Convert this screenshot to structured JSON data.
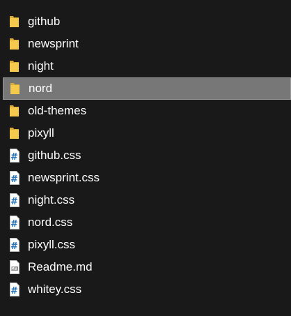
{
  "explorer": {
    "items": [
      {
        "label": "github",
        "type": "folder",
        "icon": "folder-icon"
      },
      {
        "label": "newsprint",
        "type": "folder",
        "icon": "folder-icon"
      },
      {
        "label": "night",
        "type": "folder",
        "icon": "folder-icon"
      },
      {
        "label": "nord",
        "type": "folder",
        "icon": "folder-icon",
        "selected": true
      },
      {
        "label": "old-themes",
        "type": "folder",
        "icon": "folder-icon"
      },
      {
        "label": "pixyll",
        "type": "folder",
        "icon": "folder-icon"
      },
      {
        "label": "github.css",
        "type": "css",
        "icon": "css-file-icon"
      },
      {
        "label": "newsprint.css",
        "type": "css",
        "icon": "css-file-icon"
      },
      {
        "label": "night.css",
        "type": "css",
        "icon": "css-file-icon"
      },
      {
        "label": "nord.css",
        "type": "css",
        "icon": "css-file-icon"
      },
      {
        "label": "pixyll.css",
        "type": "css",
        "icon": "css-file-icon"
      },
      {
        "label": "Readme.md",
        "type": "markdown",
        "icon": "markdown-file-icon"
      },
      {
        "label": "whitey.css",
        "type": "css",
        "icon": "css-file-icon"
      }
    ]
  },
  "colors": {
    "background": "#191919",
    "selection": "#777777",
    "folder": "#f5c94c",
    "text": "#ffffff",
    "css_hash": "#1e6fb5"
  }
}
